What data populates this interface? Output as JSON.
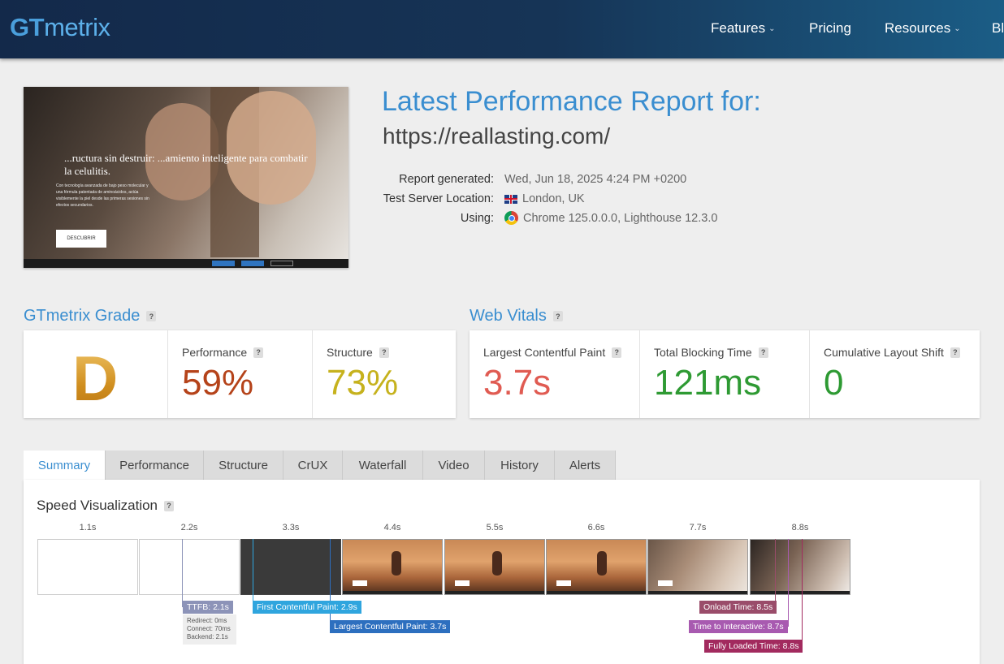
{
  "header": {
    "logo_gt": "GT",
    "logo_metrix": "metrix",
    "nav": [
      {
        "label": "Features",
        "has_dropdown": true
      },
      {
        "label": "Pricing",
        "has_dropdown": false
      },
      {
        "label": "Resources",
        "has_dropdown": true
      },
      {
        "label": "Bl",
        "has_dropdown": false
      }
    ],
    "chevron": "⌄"
  },
  "thumbnail": {
    "headline": "...ructura sin destruir: ...amiento inteligente para combatir la celulitis.",
    "body": "Con tecnología avanzada de bajo peso molecular y una fórmula patentada de aminoácidos, actúa visiblemente la piel desde las primeras sesiones sin efectos secundarios.",
    "button": "DESCUBRIR"
  },
  "report": {
    "title": "Latest Performance Report for:",
    "url": "https://reallasting.com/",
    "generated_label": "Report generated:",
    "generated_value": "Wed, Jun 18, 2025 4:24 PM +0200",
    "location_label": "Test Server Location:",
    "location_value": "London, UK",
    "using_label": "Using:",
    "using_value": "Chrome 125.0.0.0, Lighthouse 12.3.0"
  },
  "grade": {
    "section_title": "GTmetrix Grade",
    "letter": "D",
    "performance_label": "Performance",
    "performance_value": "59%",
    "structure_label": "Structure",
    "structure_value": "73%"
  },
  "vitals": {
    "section_title": "Web Vitals",
    "lcp_label": "Largest Contentful Paint",
    "lcp_value": "3.7s",
    "tbt_label": "Total Blocking Time",
    "tbt_value": "121ms",
    "cls_label": "Cumulative Layout Shift",
    "cls_value": "0"
  },
  "help_mark": "?",
  "tabs": [
    "Summary",
    "Performance",
    "Structure",
    "CrUX",
    "Waterfall",
    "Video",
    "History",
    "Alerts"
  ],
  "active_tab": "Summary",
  "speed": {
    "title": "Speed Visualization",
    "ticks": [
      "1.1s",
      "2.2s",
      "3.3s",
      "4.4s",
      "5.5s",
      "6.6s",
      "7.7s",
      "8.8s"
    ],
    "ttfb": "TTFB: 2.1s",
    "redirect": "Redirect: 0ms",
    "connect": "Connect: 70ms",
    "backend": "Backend: 2.1s",
    "fcp": "First Contentful Paint: 2.9s",
    "lcp": "Largest Contentful Paint: 3.7s",
    "onload": "Onload Time: 8.5s",
    "tti": "Time to Interactive: 8.7s",
    "fully_loaded": "Fully Loaded Time: 8.8s"
  },
  "colors": {
    "brand_blue": "#3a8ed0",
    "performance": "#b5431a",
    "structure": "#c6b21d",
    "lcp": "#e05b52",
    "good": "#2e9a33",
    "ttfb_badge": "#8c93b8",
    "fcp_badge": "#2fa5de",
    "lcp_badge": "#2d6fbf",
    "onload_badge": "#9a4c6a",
    "tti_badge": "#a85ab0",
    "fully_loaded_badge": "#a22a5e"
  }
}
